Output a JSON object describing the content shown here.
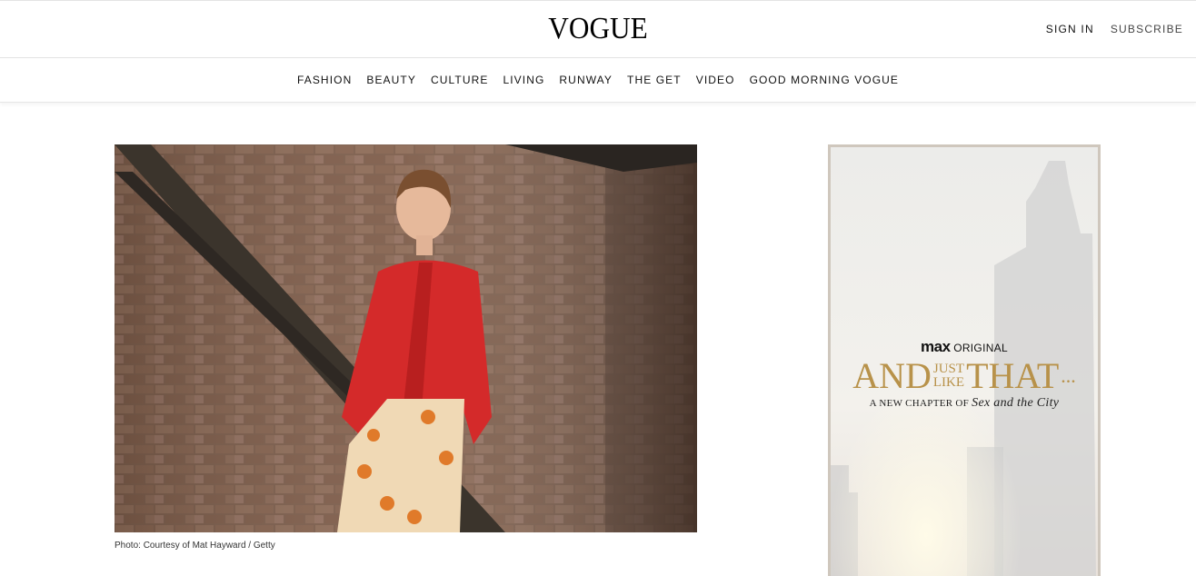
{
  "header": {
    "logo": "VOGUE",
    "sign_in": "SIGN IN",
    "subscribe": "SUBSCRIBE"
  },
  "nav": {
    "items": [
      "FASHION",
      "BEAUTY",
      "CULTURE",
      "LIVING",
      "RUNWAY",
      "THE GET",
      "VIDEO",
      "GOOD MORNING VOGUE"
    ]
  },
  "article": {
    "photo_caption": "Photo: Courtesy of Mat Hayward / Getty"
  },
  "ad": {
    "brand": "max",
    "brand_suffix": "ORIGINAL",
    "title_and": "AND",
    "title_just": "JUST",
    "title_like": "LIKE",
    "title_that": "THAT",
    "title_dots": "...",
    "subtitle_prefix": "A NEW CHAPTER OF",
    "subtitle_script": "Sex and the City"
  },
  "colors": {
    "ad_gold": "#b8924a",
    "ad_border": "#cfc7bd",
    "blouse_red": "#d42a2a"
  }
}
